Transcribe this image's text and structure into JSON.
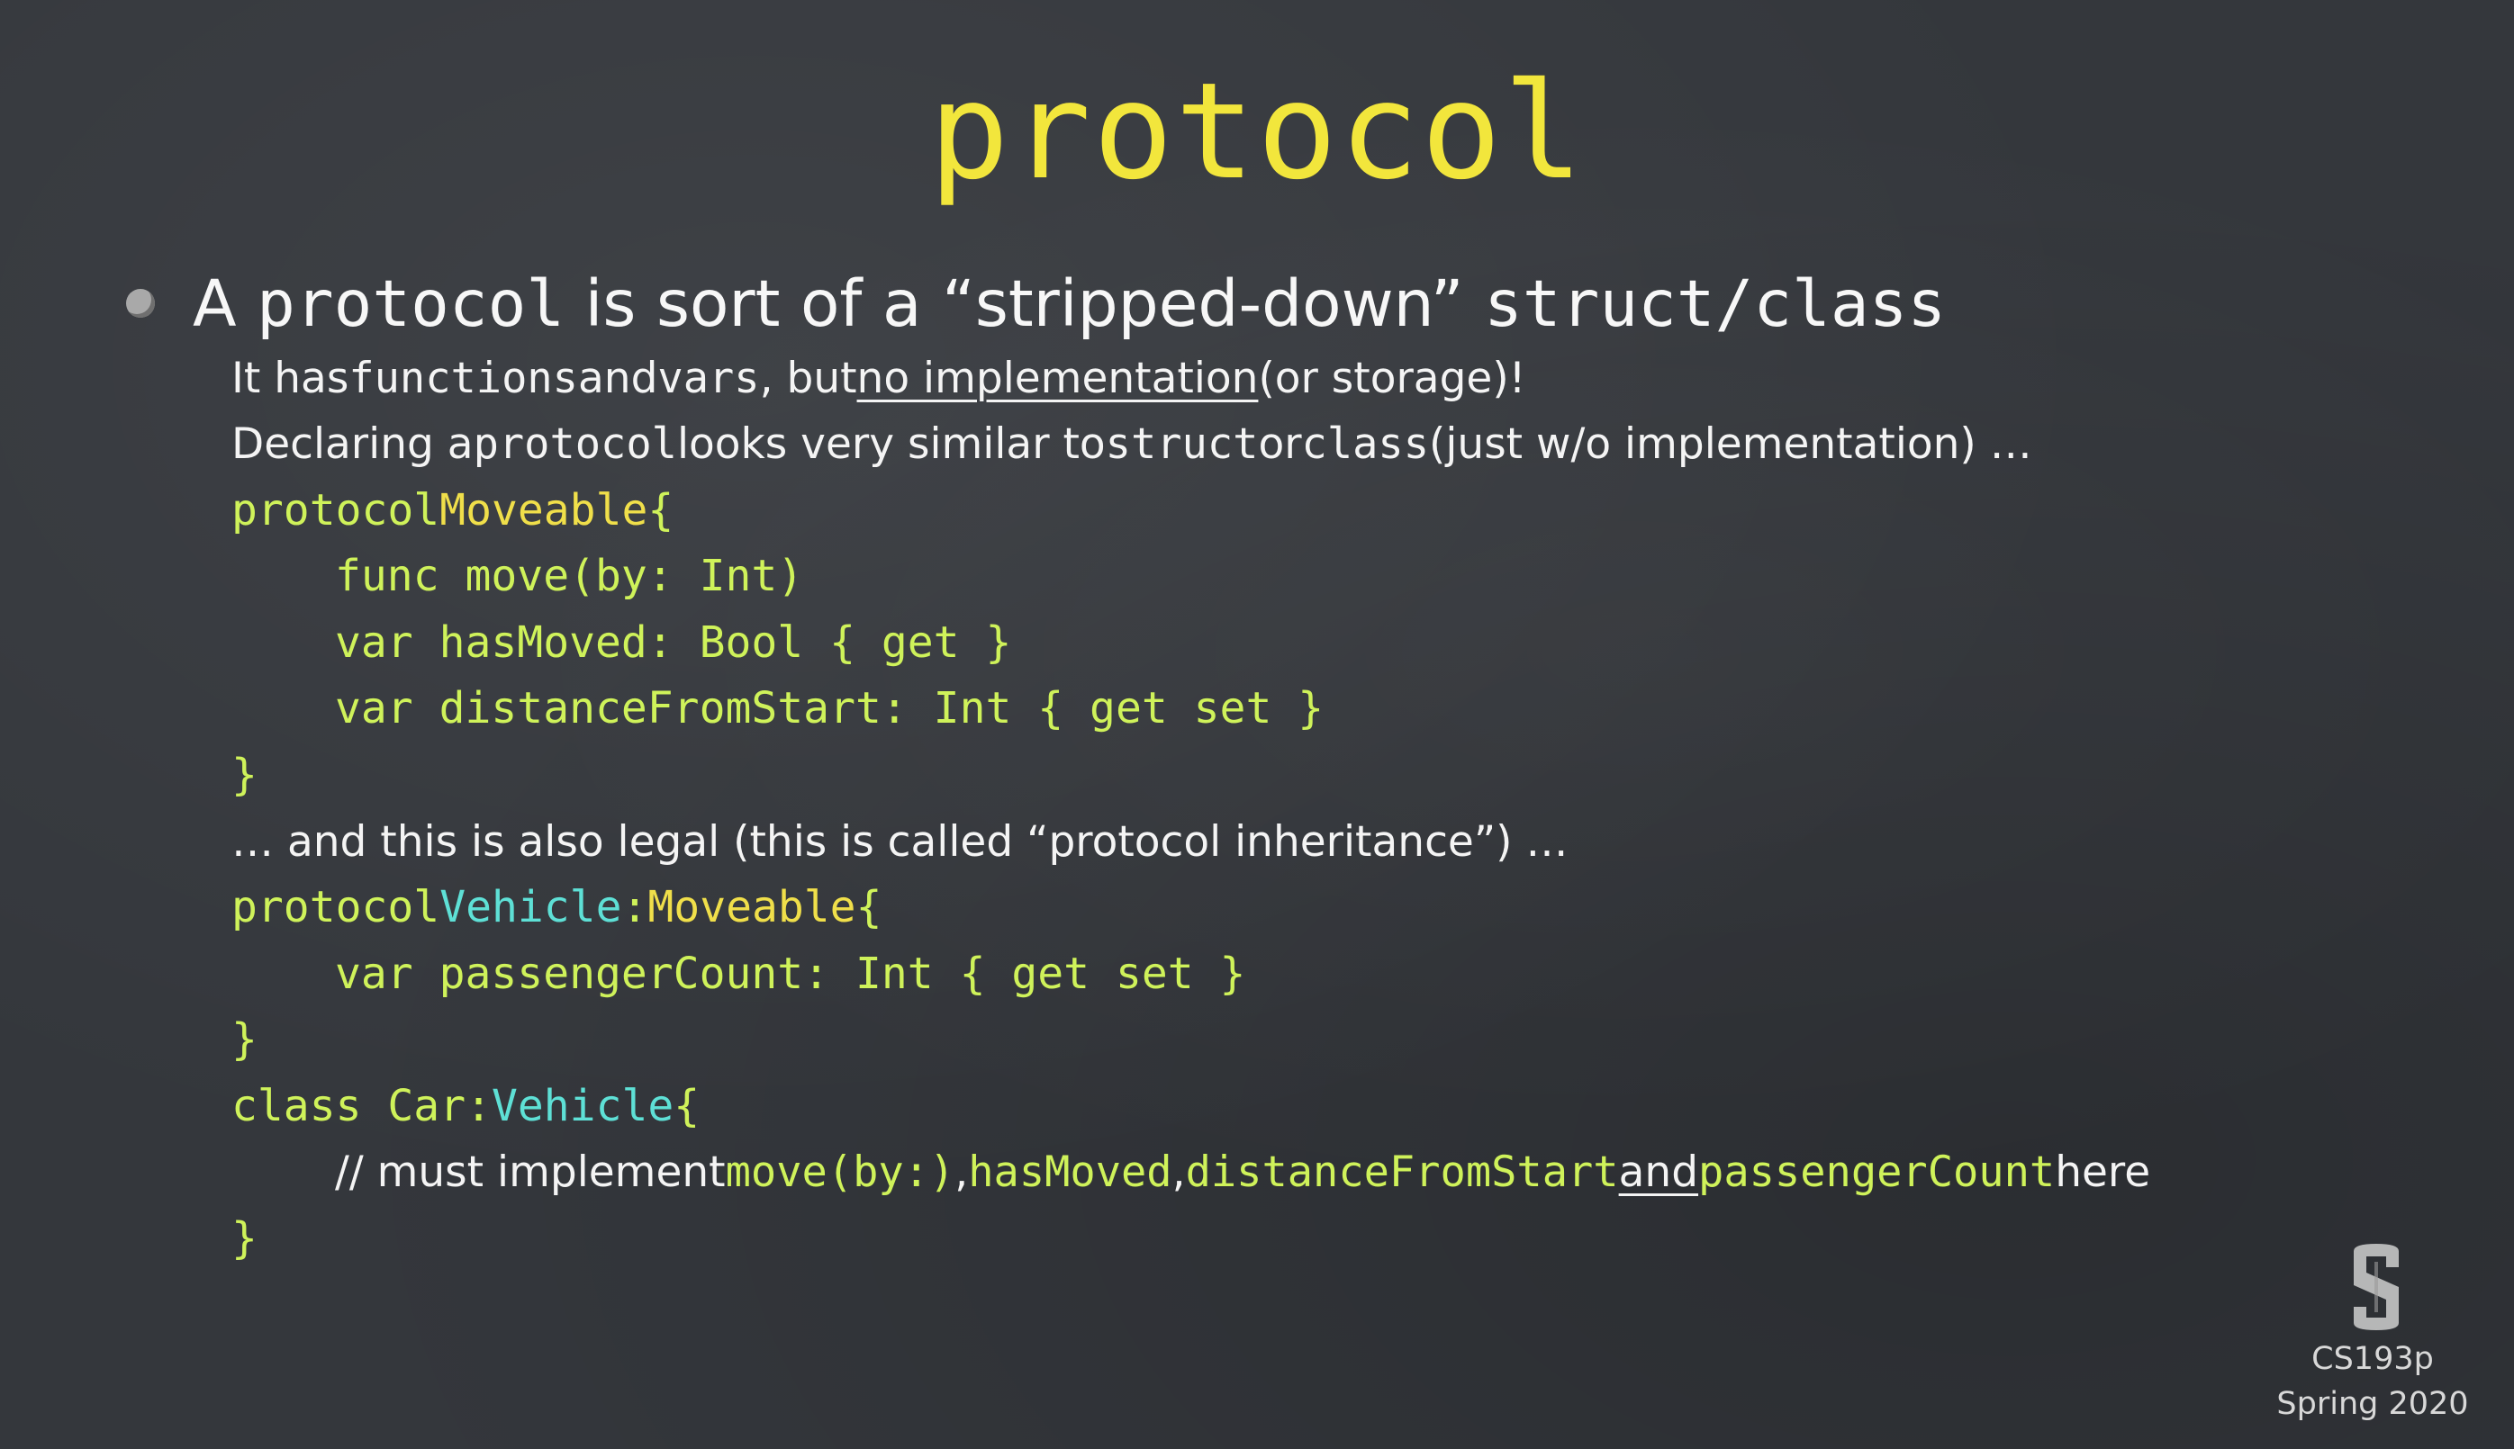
{
  "slide": {
    "title": "protocol",
    "bullet": {
      "part1": "A ",
      "part2": "protocol",
      "part3": " is sort of a “stripped-down” ",
      "part4": "struct/class"
    },
    "line1": {
      "a": "It has ",
      "b": "functions",
      "c": " and ",
      "d": "vars",
      "e": ", but ",
      "f": "no implementation",
      "g": " (or storage)!"
    },
    "line2": {
      "a": "Declaring a ",
      "b": "protocol",
      "c": " looks very similar to ",
      "d": "struct",
      "e": " or ",
      "f": "class",
      "g": " (just w/o implementation) …"
    },
    "code1": {
      "l1a": "protocol ",
      "l1b": "Moveable",
      "l1c": " {",
      "l2": "func move(by: Int)",
      "l3": "var hasMoved: Bool { get }",
      "l4": "var distanceFromStart: Int { get set }",
      "l5": "}"
    },
    "line3": "… and this is also legal (this is called “protocol inheritance”) …",
    "code2": {
      "l1a": "protocol ",
      "l1b": "Vehicle",
      "l1c": ": ",
      "l1d": "Moveable",
      "l1e": " {",
      "l2": "var passengerCount: Int { get set }",
      "l3": "}"
    },
    "code3": {
      "l1a": "class Car: ",
      "l1b": "Vehicle",
      "l1c": " {",
      "l2a": "// must implement ",
      "l2b": "move(by:)",
      "l2c": ", ",
      "l2d": "hasMoved",
      "l2e": ", ",
      "l2f": "distanceFromStart",
      "l2g": " ",
      "l2h": "and",
      "l2i": " ",
      "l2j": "passengerCount",
      "l2k": " here",
      "l3": "}"
    }
  },
  "corner": {
    "logo_icon": "stanford-s-logo",
    "course": "CS193p",
    "term": "Spring 2020"
  },
  "colors": {
    "background": "#34373c",
    "title": "#f2e63c",
    "type_name": "#f0df4a",
    "protocol_name": "#5ee0d6",
    "code": "#cff25a"
  }
}
